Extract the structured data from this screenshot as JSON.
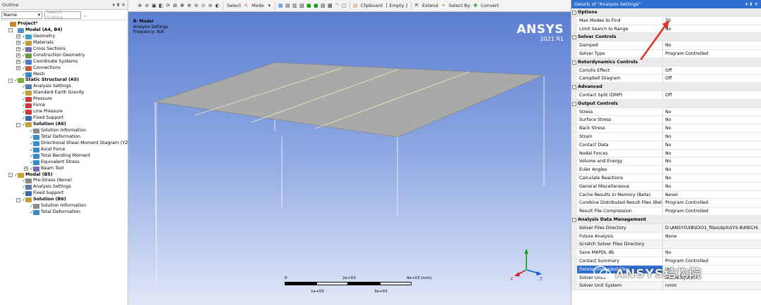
{
  "outline": {
    "title": "Outline",
    "pin": "▾ ⬍ ✕",
    "filter_value": "Name",
    "search_placeholder": "Search Outline",
    "tree": [
      {
        "label": "Project*",
        "indent": 0,
        "bold": true,
        "icon": "project-icon",
        "color": "#c48a2a",
        "check": false,
        "exp": ""
      },
      {
        "label": "Model (A4, B4)",
        "indent": 1,
        "bold": true,
        "icon": "model-icon",
        "color": "#5a8fd0",
        "check": false,
        "exp": "-"
      },
      {
        "label": "Geometry",
        "indent": 2,
        "bold": false,
        "icon": "geometry-icon",
        "color": "#3aa0c8",
        "check": true,
        "exp": "+"
      },
      {
        "label": "Materials",
        "indent": 2,
        "bold": false,
        "icon": "materials-icon",
        "color": "#c49a3a",
        "check": true,
        "exp": "+"
      },
      {
        "label": "Cross Sections",
        "indent": 2,
        "bold": false,
        "icon": "cross-sections-icon",
        "color": "#7a6ab0",
        "check": true,
        "exp": "+"
      },
      {
        "label": "Construction Geometry",
        "indent": 2,
        "bold": false,
        "icon": "construction-geometry-icon",
        "color": "#6a9a4a",
        "check": true,
        "exp": "+"
      },
      {
        "label": "Coordinate Systems",
        "indent": 2,
        "bold": false,
        "icon": "coordinate-systems-icon",
        "color": "#4a7ad0",
        "check": true,
        "exp": "+"
      },
      {
        "label": "Connections",
        "indent": 2,
        "bold": false,
        "icon": "connections-icon",
        "color": "#c85a3a",
        "check": true,
        "exp": "+"
      },
      {
        "label": "Mesh",
        "indent": 2,
        "bold": false,
        "icon": "mesh-icon",
        "color": "#3a8ac8",
        "check": true,
        "exp": ""
      },
      {
        "label": "Static Structural (A5)",
        "indent": 1,
        "bold": true,
        "icon": "static-structural-icon",
        "color": "#7ab03a",
        "check": true,
        "exp": "-"
      },
      {
        "label": "Analysis Settings",
        "indent": 2,
        "bold": false,
        "icon": "analysis-settings-icon",
        "color": "#5a7ab0",
        "check": true,
        "exp": ""
      },
      {
        "label": "Standard Earth Gravity",
        "indent": 2,
        "bold": false,
        "icon": "gravity-icon",
        "color": "#c8a03a",
        "check": true,
        "exp": ""
      },
      {
        "label": "Pressure",
        "indent": 2,
        "bold": false,
        "icon": "pressure-icon",
        "color": "#c83a3a",
        "check": true,
        "exp": ""
      },
      {
        "label": "Force",
        "indent": 2,
        "bold": false,
        "icon": "force-icon",
        "color": "#c83a3a",
        "check": true,
        "exp": ""
      },
      {
        "label": "Line Pressure",
        "indent": 2,
        "bold": false,
        "icon": "line-pressure-icon",
        "color": "#c83a3a",
        "check": true,
        "exp": ""
      },
      {
        "label": "Fixed Support",
        "indent": 2,
        "bold": false,
        "icon": "fixed-support-icon",
        "color": "#3a6ab0",
        "check": true,
        "exp": ""
      },
      {
        "label": "Solution (A6)",
        "indent": 2,
        "bold": true,
        "icon": "solution-icon",
        "color": "#c8a03a",
        "check": true,
        "exp": "-"
      },
      {
        "label": "Solution Information",
        "indent": 3,
        "bold": false,
        "icon": "solution-information-icon",
        "color": "#8a8a8a",
        "check": true,
        "exp": ""
      },
      {
        "label": "Total Deformation",
        "indent": 3,
        "bold": false,
        "icon": "result-icon",
        "color": "#3a8ac8",
        "check": true,
        "exp": ""
      },
      {
        "label": "Directional Shear-Moment Diagram (YZ-",
        "indent": 3,
        "bold": false,
        "icon": "result-icon",
        "color": "#3a8ac8",
        "check": true,
        "exp": ""
      },
      {
        "label": "Axial Force",
        "indent": 3,
        "bold": false,
        "icon": "result-icon",
        "color": "#3a8ac8",
        "check": true,
        "exp": ""
      },
      {
        "label": "Total Bending Moment",
        "indent": 3,
        "bold": false,
        "icon": "result-icon",
        "color": "#3a8ac8",
        "check": true,
        "exp": ""
      },
      {
        "label": "Equivalent Stress",
        "indent": 3,
        "bold": false,
        "icon": "result-icon",
        "color": "#3a8ac8",
        "check": true,
        "exp": ""
      },
      {
        "label": "Beam Tool",
        "indent": 3,
        "bold": false,
        "icon": "beam-tool-icon",
        "color": "#7a6ab0",
        "check": true,
        "exp": "+"
      },
      {
        "label": "Modal (B5)",
        "indent": 1,
        "bold": true,
        "icon": "modal-icon",
        "color": "#c8a03a",
        "check": true,
        "exp": "-"
      },
      {
        "label": "Pre-Stress (None)",
        "indent": 2,
        "bold": false,
        "icon": "pre-stress-icon",
        "color": "#8a8a8a",
        "check": true,
        "exp": ""
      },
      {
        "label": "Analysis Settings",
        "indent": 2,
        "bold": false,
        "icon": "analysis-settings-icon",
        "color": "#5a7ab0",
        "check": true,
        "exp": ""
      },
      {
        "label": "Fixed Support",
        "indent": 2,
        "bold": false,
        "icon": "fixed-support-icon",
        "color": "#3a6ab0",
        "check": true,
        "exp": ""
      },
      {
        "label": "Solution (B6)",
        "indent": 2,
        "bold": true,
        "icon": "solution-icon",
        "color": "#c8a03a",
        "check": true,
        "exp": "-"
      },
      {
        "label": "Solution Information",
        "indent": 3,
        "bold": false,
        "icon": "solution-information-icon",
        "color": "#8a8a8a",
        "check": true,
        "exp": ""
      },
      {
        "label": "Total Deformation",
        "indent": 3,
        "bold": false,
        "icon": "result-icon",
        "color": "#3a8ac8",
        "check": true,
        "exp": ""
      }
    ]
  },
  "toolbar": {
    "select_label": "Select",
    "mode_label": "Mode",
    "clipboard_label": "Clipboard",
    "empty_label": "[ Empty ]",
    "extend_label": "Extend",
    "select_by_label": "Select By",
    "convert_label": "Convert"
  },
  "viewport": {
    "title": "B: Modal",
    "subtitle": "Analysis Settings",
    "frequency": "Frequency: N/A",
    "brand": "ANSYS",
    "version": "2021 R1",
    "scale_labels": {
      "l0": "0",
      "l1": "2e+03",
      "l2": "4e+03 (mm)",
      "l3": "1e+03",
      "l4": "3e+03"
    }
  },
  "details": {
    "title": "Details of \"Analysis Settings\"",
    "title_controls": "▾ ⬍ ✕",
    "rows": [
      {
        "type": "section",
        "label": "Options"
      },
      {
        "type": "row",
        "key": "Max Modes to Find",
        "value": "30"
      },
      {
        "type": "row",
        "key": "Limit Search to Range",
        "value": "No"
      },
      {
        "type": "section",
        "label": "Solver Controls"
      },
      {
        "type": "row",
        "key": "Damped",
        "value": "No"
      },
      {
        "type": "row",
        "key": "Solver Type",
        "value": "Program Controlled"
      },
      {
        "type": "section",
        "label": "Rotordynamics Controls"
      },
      {
        "type": "row",
        "key": "Coriolis Effect",
        "value": "Off"
      },
      {
        "type": "row",
        "key": "Campbell Diagram",
        "value": "Off"
      },
      {
        "type": "section",
        "label": "Advanced"
      },
      {
        "type": "row",
        "key": "Contact Split (DMP)",
        "value": "Off"
      },
      {
        "type": "section",
        "label": "Output Controls"
      },
      {
        "type": "row",
        "key": "Stress",
        "value": "No"
      },
      {
        "type": "row",
        "key": "Surface Stress",
        "value": "No"
      },
      {
        "type": "row",
        "key": "Back Stress",
        "value": "No"
      },
      {
        "type": "row",
        "key": "Strain",
        "value": "No"
      },
      {
        "type": "row",
        "key": "Contact Data",
        "value": "No"
      },
      {
        "type": "row",
        "key": "Nodal Forces",
        "value": "No"
      },
      {
        "type": "row",
        "key": "Volume and Energy",
        "value": "No"
      },
      {
        "type": "row",
        "key": "Euler Angles",
        "value": "No"
      },
      {
        "type": "row",
        "key": "Calculate Reactions",
        "value": "No"
      },
      {
        "type": "row",
        "key": "General Miscellaneous",
        "value": "No"
      },
      {
        "type": "row",
        "key": "Cache Results in Memory (Beta)",
        "value": "Never"
      },
      {
        "type": "row",
        "key": "Combine Distributed Result Files (Beta)",
        "value": "Program Controlled"
      },
      {
        "type": "row",
        "key": "Result File Compression",
        "value": "Program Controlled"
      },
      {
        "type": "section",
        "label": "Analysis Data Management"
      },
      {
        "type": "row",
        "key": "Solver Files Directory",
        "value": "D:\\ANSYS\\XB\\EX01_files\\dp0\\SYS-8\\MECH\\",
        "shade": true
      },
      {
        "type": "row",
        "key": "Future Analysis",
        "value": "None"
      },
      {
        "type": "row",
        "key": "Scratch Solver Files Directory",
        "value": "",
        "shade": true
      },
      {
        "type": "row",
        "key": "Save MAPDL db",
        "value": "No"
      },
      {
        "type": "row",
        "key": "Contact Summary",
        "value": "Program Controlled"
      },
      {
        "type": "row",
        "key": "Delete Unneeded Files",
        "value": "Yes",
        "hl": true
      },
      {
        "type": "row",
        "key": "Solver Units",
        "value": "Active System"
      },
      {
        "type": "row",
        "key": "Solver Unit System",
        "value": "nmm",
        "shade": true
      }
    ]
  },
  "watermark": {
    "text": "ANSYS结构院"
  },
  "colors": {
    "accent": "#2f6fd0",
    "check": "#1a9a1a",
    "plate": "#a9a9a9",
    "annotation": "#e0302a"
  }
}
